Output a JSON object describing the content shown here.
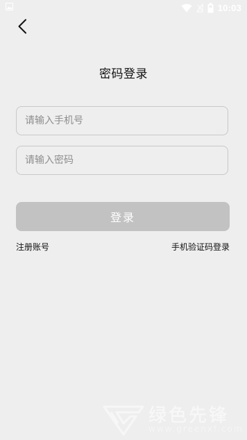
{
  "status_bar": {
    "time": "10:03",
    "icons": [
      "image-icon",
      "wifi-icon",
      "signal-icon",
      "battery-icon"
    ]
  },
  "nav": {
    "back_icon": "chevron-left-icon"
  },
  "page": {
    "title": "密码登录"
  },
  "form": {
    "phone_placeholder": "请输入手机号",
    "password_placeholder": "请输入密码",
    "login_label": "登录"
  },
  "links": {
    "register": "注册账号",
    "sms_login": "手机验证码登录"
  },
  "watermark": {
    "text": "绿色先锋",
    "url": "www.greenxf.com"
  },
  "colors": {
    "background": "#eeeeee",
    "button_disabled": "#c2c2c2",
    "field_border": "#c8c8c8",
    "placeholder": "#8e8e8e"
  }
}
